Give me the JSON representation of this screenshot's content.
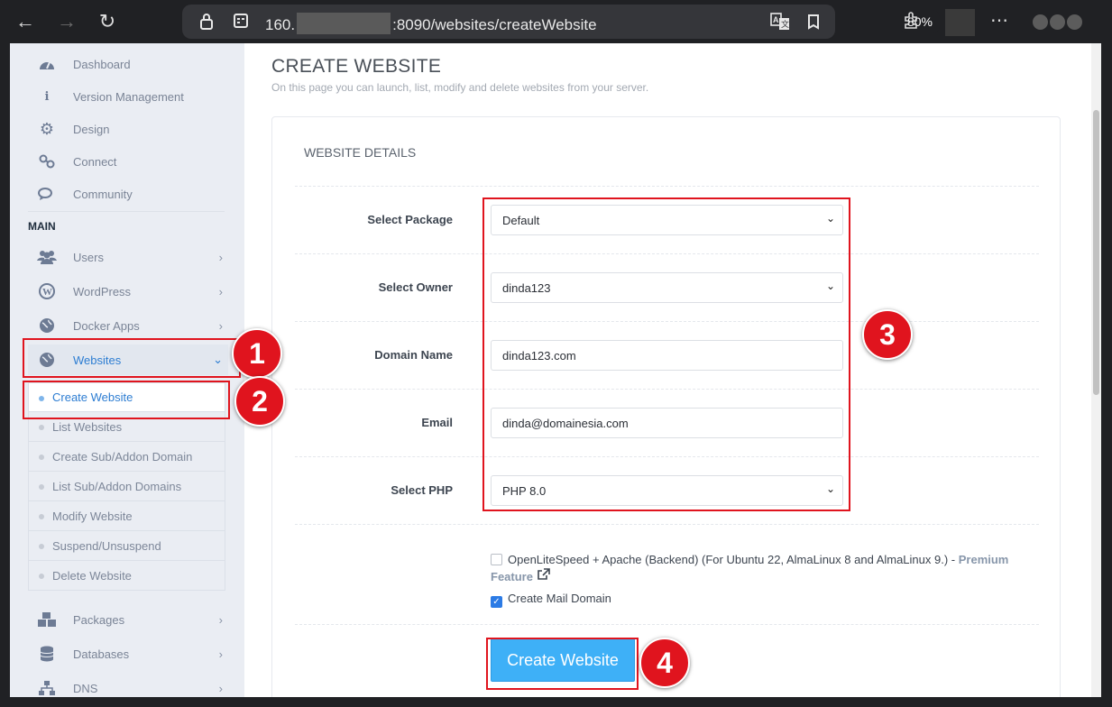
{
  "browser": {
    "url_prefix": "160.",
    "url_suffix": ":8090/websites/createWebsite",
    "zoom": "80%"
  },
  "sidebar": {
    "top_items": [
      {
        "label": "Dashboard",
        "icon": "dashboard-icon"
      },
      {
        "label": "Version Management",
        "icon": "info-icon"
      },
      {
        "label": "Design",
        "icon": "gear-icon"
      },
      {
        "label": "Connect",
        "icon": "link-icon"
      },
      {
        "label": "Community",
        "icon": "comments-icon"
      }
    ],
    "section_heading": "MAIN",
    "main_items": [
      {
        "label": "Users",
        "icon": "users-icon"
      },
      {
        "label": "WordPress",
        "icon": "wordpress-icon"
      },
      {
        "label": "Docker Apps",
        "icon": "globe-icon"
      },
      {
        "label": "Websites",
        "icon": "globe-icon"
      }
    ],
    "website_subitems": [
      "Create Website",
      "List Websites",
      "Create Sub/Addon Domain",
      "List Sub/Addon Domains",
      "Modify Website",
      "Suspend/Unsuspend",
      "Delete Website"
    ],
    "lower_items": [
      {
        "label": "Packages",
        "icon": "cubes-icon"
      },
      {
        "label": "Databases",
        "icon": "database-icon"
      },
      {
        "label": "DNS",
        "icon": "sitemap-icon"
      }
    ]
  },
  "main": {
    "title": "CREATE WEBSITE",
    "subtitle": "On this page you can launch, list, modify and delete websites from your server.",
    "panel_title": "WEBSITE DETAILS",
    "fields": {
      "package": {
        "label": "Select Package",
        "value": "Default"
      },
      "owner": {
        "label": "Select Owner",
        "value": "dinda123"
      },
      "domain": {
        "label": "Domain Name",
        "value": "dinda123.com"
      },
      "email": {
        "label": "Email",
        "value": "dinda@domainesia.com"
      },
      "php": {
        "label": "Select PHP",
        "value": "PHP 8.0"
      }
    },
    "ols_option": "OpenLiteSpeed + Apache (Backend) (For Ubuntu 22, AlmaLinux 8 and AlmaLinux 9.) -",
    "premium_word": "Premium",
    "feature_word": "Feature",
    "mail_option": "Create Mail Domain",
    "create_button": "Create Website"
  },
  "annotations": [
    "1",
    "2",
    "3",
    "4"
  ],
  "colors": {
    "annotation_red": "#e0141e",
    "button_blue": "#3eb0f7",
    "sidebar_bg": "#eaedf3",
    "active_blue": "#2d7dd2"
  }
}
